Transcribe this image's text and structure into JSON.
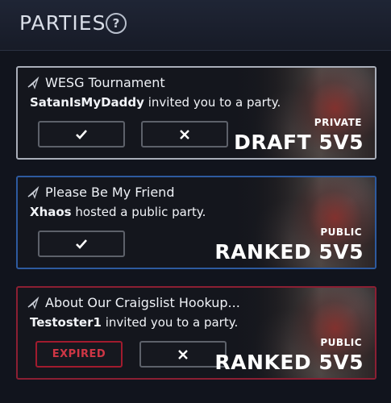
{
  "header": {
    "title": "PARTIES",
    "help_icon": "question-icon"
  },
  "parties": [
    {
      "name": "WESG Tournament",
      "host": "SatanIsMyDaddy",
      "message": "invited you to a party.",
      "privacy": "PRIVATE",
      "mode": "DRAFT 5V5",
      "border_color": "#a9aeb9",
      "status": "invite"
    },
    {
      "name": "Please Be My Friend",
      "host": "Xhaos",
      "message": "hosted a public party.",
      "privacy": "PUBLIC",
      "mode": "RANKED 5V5",
      "border_color": "#2d5a9f",
      "status": "public"
    },
    {
      "name": "About Our Craigslist Hookup...",
      "host": "Testoster1",
      "message": "invited you to a party.",
      "privacy": "PUBLIC",
      "mode": "RANKED 5V5",
      "border_color": "#8b1f33",
      "status": "expired",
      "expired_label": "EXPIRED"
    }
  ],
  "icons": {
    "party": "plane-icon",
    "accept": "check-icon",
    "decline": "close-icon"
  }
}
